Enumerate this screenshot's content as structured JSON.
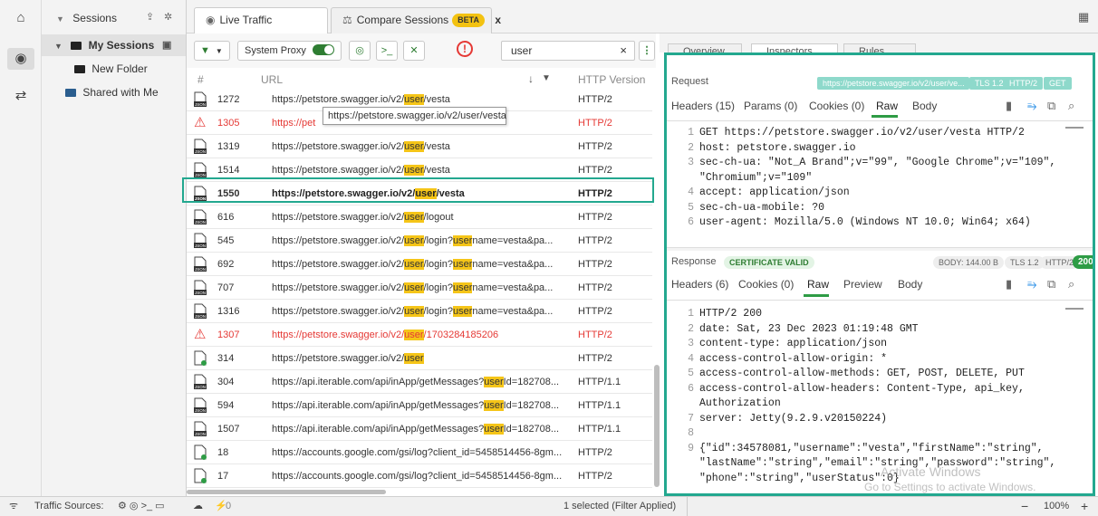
{
  "sidebar": {
    "title": "Sessions",
    "my_sessions": "My Sessions",
    "new_folder": "New Folder",
    "shared": "Shared with Me"
  },
  "tabs": {
    "live": "Live Traffic",
    "compare": "Compare Sessions",
    "beta": "BETA",
    "close": "x"
  },
  "toolbar": {
    "system_proxy": "System Proxy",
    "search_value": "user",
    "clear": "×"
  },
  "table": {
    "headers": {
      "num": "#",
      "url": "URL",
      "version": "HTTP Version",
      "sort": "↓"
    },
    "rows": [
      {
        "id": "1272",
        "pre": "https://petstore.swagger.io/v2/",
        "hl": "user",
        "post": "/vesta",
        "ver": "HTTP/2",
        "icon": "json",
        "status": ""
      },
      {
        "id": "1305",
        "pre": "https://pet",
        "hl": "",
        "post": "",
        "ver": "HTTP/2",
        "icon": "warn",
        "status": "error"
      },
      {
        "id": "1319",
        "pre": "https://petstore.swagger.io/v2/",
        "hl": "user",
        "post": "/vesta",
        "ver": "HTTP/2",
        "icon": "json",
        "status": ""
      },
      {
        "id": "1514",
        "pre": "https://petstore.swagger.io/v2/",
        "hl": "user",
        "post": "/vesta",
        "ver": "HTTP/2",
        "icon": "json",
        "status": ""
      },
      {
        "id": "1550",
        "pre": "https://petstore.swagger.io/v2/",
        "hl": "user",
        "post": "/vesta",
        "ver": "HTTP/2",
        "icon": "json",
        "status": "selected"
      },
      {
        "id": "616",
        "pre": "https://petstore.swagger.io/v2/",
        "hl": "user",
        "post": "/logout",
        "ver": "HTTP/2",
        "icon": "json",
        "status": ""
      },
      {
        "id": "545",
        "pre": "https://petstore.swagger.io/v2/",
        "hl": "user",
        "post": "/login?",
        "hl2": "user",
        "post2": "name=vesta&pa...",
        "ver": "HTTP/2",
        "icon": "json",
        "status": ""
      },
      {
        "id": "692",
        "pre": "https://petstore.swagger.io/v2/",
        "hl": "user",
        "post": "/login?",
        "hl2": "user",
        "post2": "name=vesta&pa...",
        "ver": "HTTP/2",
        "icon": "json",
        "status": ""
      },
      {
        "id": "707",
        "pre": "https://petstore.swagger.io/v2/",
        "hl": "user",
        "post": "/login?",
        "hl2": "user",
        "post2": "name=vesta&pa...",
        "ver": "HTTP/2",
        "icon": "json",
        "status": ""
      },
      {
        "id": "1316",
        "pre": "https://petstore.swagger.io/v2/",
        "hl": "user",
        "post": "/login?",
        "hl2": "user",
        "post2": "name=vesta&pa...",
        "ver": "HTTP/2",
        "icon": "json",
        "status": ""
      },
      {
        "id": "1307",
        "pre": "https://petstore.swagger.io/v2/",
        "hl": "user",
        "post": "/1703284185206",
        "ver": "HTTP/2",
        "icon": "warn",
        "status": "error"
      },
      {
        "id": "314",
        "pre": "https://petstore.swagger.io/v2/",
        "hl": "user",
        "post": "",
        "ver": "HTTP/2",
        "icon": "doc",
        "status": ""
      },
      {
        "id": "304",
        "pre": "https://api.iterable.com/api/inApp/getMessages?",
        "hl": "user",
        "post": "Id=182708...",
        "ver": "HTTP/1.1",
        "icon": "json",
        "status": ""
      },
      {
        "id": "594",
        "pre": "https://api.iterable.com/api/inApp/getMessages?",
        "hl": "user",
        "post": "Id=182708...",
        "ver": "HTTP/1.1",
        "icon": "json",
        "status": ""
      },
      {
        "id": "1507",
        "pre": "https://api.iterable.com/api/inApp/getMessages?",
        "hl": "user",
        "post": "Id=182708...",
        "ver": "HTTP/1.1",
        "icon": "json",
        "status": ""
      },
      {
        "id": "18",
        "pre": "https://accounts.google.com/gsi/log?client_id=5458514456-8gm...",
        "hl": "",
        "post": "",
        "ver": "HTTP/2",
        "icon": "doc",
        "status": ""
      },
      {
        "id": "17",
        "pre": "https://accounts.google.com/gsi/log?client_id=5458514456-8gm...",
        "hl": "",
        "post": "",
        "ver": "HTTP/2",
        "icon": "doc",
        "status": ""
      }
    ],
    "tooltip": "https://petstore.swagger.io/v2/user/vesta"
  },
  "detail": {
    "tabs": {
      "overview": "Overview",
      "inspectors": "Inspectors",
      "rules": "Rules"
    },
    "request": {
      "label": "Request",
      "url": "https://petstore.swagger.io/v2/user/ve...",
      "tls": "TLS 1.2",
      "http": "HTTP/2",
      "method": "GET",
      "subtabs": {
        "headers": "Headers (15)",
        "params": "Params (0)",
        "cookies": "Cookies (0)",
        "raw": "Raw",
        "body": "Body"
      },
      "lines": [
        {
          "n": "1",
          "t": "GET https://petstore.swagger.io/v2/user/vesta HTTP/2"
        },
        {
          "n": "2",
          "t": "host: petstore.swagger.io"
        },
        {
          "n": "3",
          "t": "sec-ch-ua: \"Not_A Brand\";v=\"99\", \"Google Chrome\";v=\"109\","
        },
        {
          "n": "",
          "t": "\"Chromium\";v=\"109\""
        },
        {
          "n": "4",
          "t": "accept: application/json"
        },
        {
          "n": "5",
          "t": "sec-ch-ua-mobile: ?0"
        },
        {
          "n": "6",
          "t": "user-agent: Mozilla/5.0 (Windows NT 10.0; Win64; x64)"
        }
      ]
    },
    "response": {
      "label": "Response",
      "cert": "CERTIFICATE VALID",
      "body_size": "BODY: 144.00 B",
      "tls": "TLS 1.2",
      "http": "HTTP/2",
      "code": "200",
      "subtabs": {
        "headers": "Headers (6)",
        "cookies": "Cookies (0)",
        "raw": "Raw",
        "preview": "Preview",
        "body": "Body"
      },
      "lines": [
        {
          "n": "1",
          "t": "HTTP/2 200"
        },
        {
          "n": "2",
          "t": "date: Sat, 23 Dec 2023 01:19:48 GMT"
        },
        {
          "n": "3",
          "t": "content-type: application/json"
        },
        {
          "n": "4",
          "t": "access-control-allow-origin: *"
        },
        {
          "n": "5",
          "t": "access-control-allow-methods: GET, POST, DELETE, PUT"
        },
        {
          "n": "6",
          "t": "access-control-allow-headers: Content-Type, api_key,"
        },
        {
          "n": "",
          "t": "Authorization"
        },
        {
          "n": "7",
          "t": "server: Jetty(9.2.9.v20150224)"
        },
        {
          "n": "8",
          "t": ""
        },
        {
          "n": "9",
          "t": "{\"id\":34578081,\"username\":\"vesta\",\"firstName\":\"string\","
        },
        {
          "n": "",
          "t": "\"lastName\":\"string\",\"email\":\"string\",\"password\":\"string\","
        },
        {
          "n": "",
          "t": "\"phone\":\"string\",\"userStatus\":0}"
        }
      ]
    },
    "watermark1": "Activate Windows",
    "watermark2": "Go to Settings to activate Windows."
  },
  "status": {
    "sources": "Traffic Sources:",
    "count": "0",
    "filter": "1 selected (Filter Applied)",
    "zoom": "100%",
    "minus": "−",
    "plus": "+"
  },
  "colors": {
    "accent": "#23a88f",
    "green": "#2e7d32",
    "error": "#e53935",
    "highlight": "#f5c518"
  }
}
